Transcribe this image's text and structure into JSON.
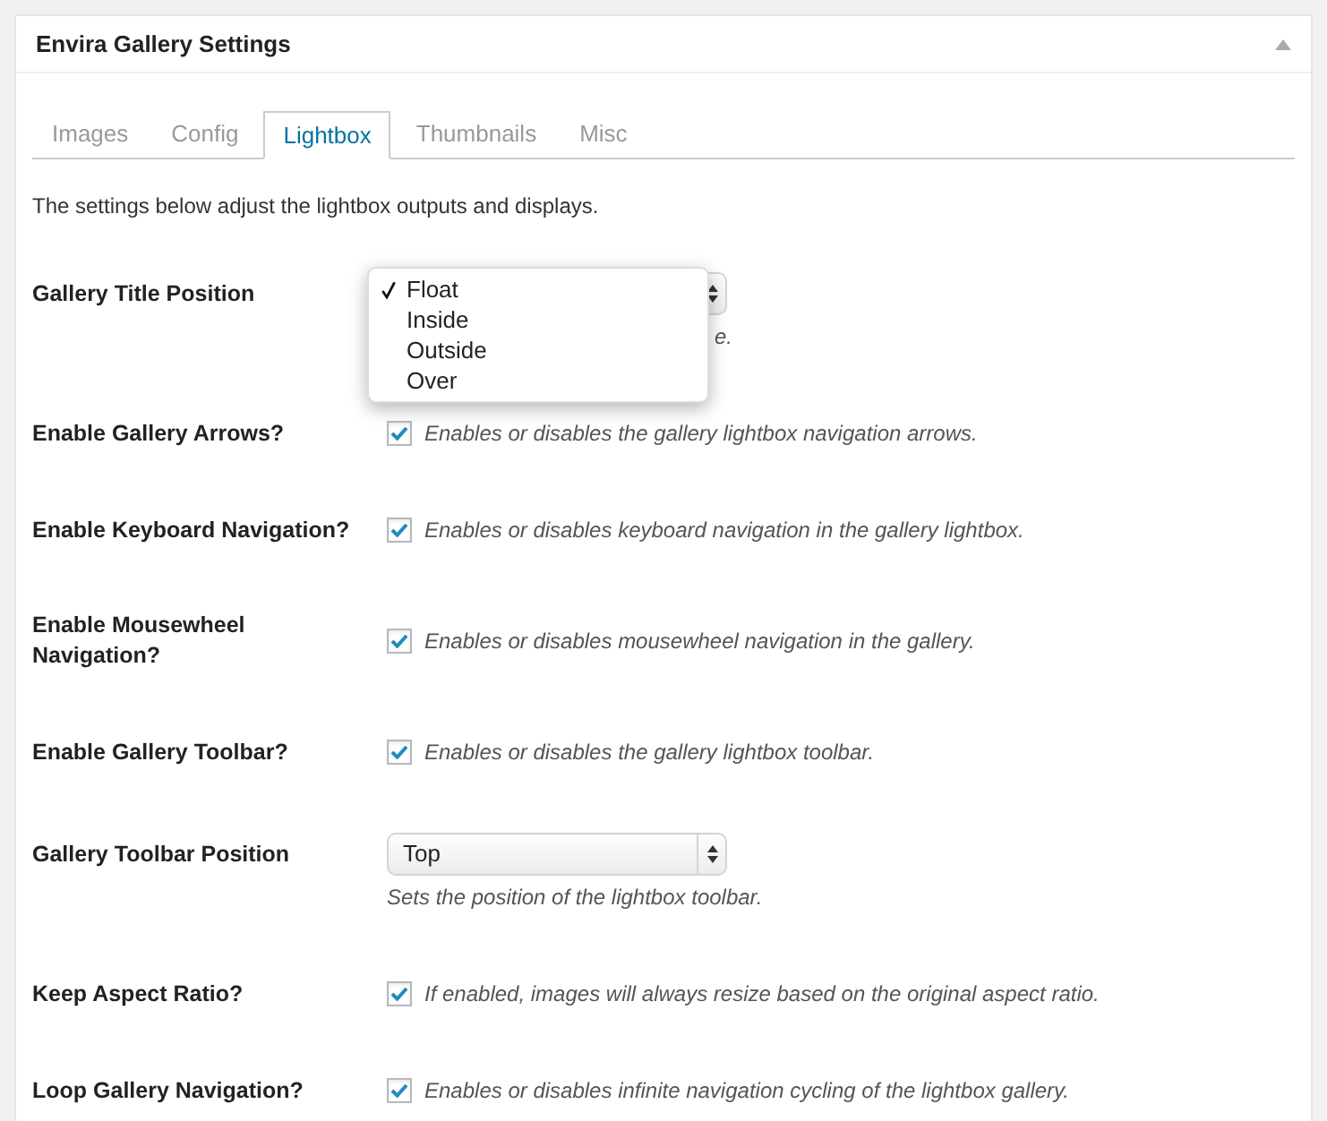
{
  "panel": {
    "title": "Envira Gallery Settings"
  },
  "tabs": [
    {
      "label": "Images",
      "selected": false
    },
    {
      "label": "Config",
      "selected": false
    },
    {
      "label": "Lightbox",
      "selected": true
    },
    {
      "label": "Thumbnails",
      "selected": false
    },
    {
      "label": "Misc",
      "selected": false
    }
  ],
  "intro": "The settings below adjust the lightbox outputs and displays.",
  "settings": [
    {
      "kind": "select",
      "label": "Gallery Title Position",
      "description": "e.",
      "open": true,
      "options": [
        {
          "label": "Float",
          "selected": true
        },
        {
          "label": "Inside",
          "selected": false
        },
        {
          "label": "Outside",
          "selected": false
        },
        {
          "label": "Over",
          "selected": false
        }
      ]
    },
    {
      "kind": "checkbox",
      "label": "Enable Gallery Arrows?",
      "checked": true,
      "description": "Enables or disables the gallery lightbox navigation arrows."
    },
    {
      "kind": "checkbox",
      "label": "Enable Keyboard Navigation?",
      "checked": true,
      "description": "Enables or disables keyboard navigation in the gallery lightbox."
    },
    {
      "kind": "checkbox",
      "label": "Enable Mousewheel Navigation?",
      "checked": true,
      "description": "Enables or disables mousewheel navigation in the gallery."
    },
    {
      "kind": "checkbox",
      "label": "Enable Gallery Toolbar?",
      "checked": true,
      "description": "Enables or disables the gallery lightbox toolbar."
    },
    {
      "kind": "select",
      "label": "Gallery Toolbar Position",
      "value": "Top",
      "description": "Sets the position of the lightbox toolbar."
    },
    {
      "kind": "checkbox",
      "label": "Keep Aspect Ratio?",
      "checked": true,
      "description": "If enabled, images will always resize based on the original aspect ratio."
    },
    {
      "kind": "checkbox",
      "label": "Loop Gallery Navigation?",
      "checked": true,
      "description": "Enables or disables infinite navigation cycling of the lightbox gallery."
    }
  ]
}
